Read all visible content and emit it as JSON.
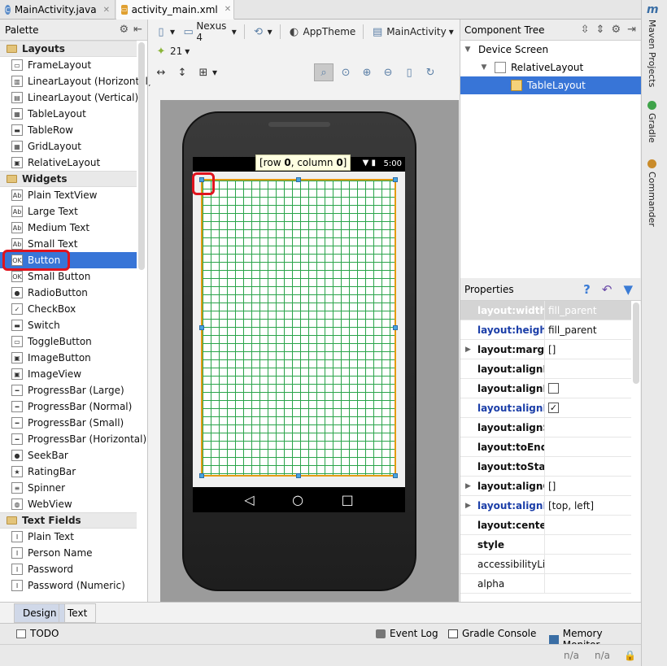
{
  "tabs": [
    {
      "label": "MainActivity.java",
      "icon": "java-class-icon"
    },
    {
      "label": "activity_main.xml",
      "icon": "xml-layout-icon"
    }
  ],
  "right_strip": {
    "top_label": "m",
    "items": [
      "Maven Projects",
      "Gradle",
      "Commander"
    ]
  },
  "palette": {
    "title": "Palette",
    "categories": [
      {
        "label": "Layouts",
        "items": [
          "FrameLayout",
          "LinearLayout (Horizontal)",
          "LinearLayout (Vertical)",
          "TableLayout",
          "TableRow",
          "GridLayout",
          "RelativeLayout"
        ]
      },
      {
        "label": "Widgets",
        "items": [
          "Plain TextView",
          "Large Text",
          "Medium Text",
          "Small Text",
          "Button",
          "Small Button",
          "RadioButton",
          "CheckBox",
          "Switch",
          "ToggleButton",
          "ImageButton",
          "ImageView",
          "ProgressBar (Large)",
          "ProgressBar (Normal)",
          "ProgressBar (Small)",
          "ProgressBar (Horizontal)",
          "SeekBar",
          "RatingBar",
          "Spinner",
          "WebView"
        ]
      },
      {
        "label": "Text Fields",
        "items": [
          "Plain Text",
          "Person Name",
          "Password",
          "Password (Numeric)"
        ]
      }
    ],
    "selected_item": "Button"
  },
  "toolbar": {
    "device": "Nexus 4",
    "theme": "AppTheme",
    "activity": "MainActivity",
    "api_level": "21"
  },
  "preview": {
    "tooltip_prefix": "[row ",
    "tooltip_row": "0",
    "tooltip_mid": ", column ",
    "tooltip_col": "0",
    "tooltip_suffix": "]",
    "status_time": "5:00"
  },
  "component_tree": {
    "title": "Component Tree",
    "nodes": [
      {
        "label": "Device Screen",
        "level": 0
      },
      {
        "label": "RelativeLayout",
        "level": 1
      },
      {
        "label": "TableLayout",
        "level": 2,
        "selected": true
      }
    ]
  },
  "properties": {
    "title": "Properties",
    "rows": [
      {
        "name": "layout:width",
        "value": "fill_parent",
        "style": "header"
      },
      {
        "name": "layout:height",
        "value": "fill_parent",
        "style": "blue"
      },
      {
        "name": "layout:margin",
        "value": "[]",
        "style": "bold",
        "expandable": true
      },
      {
        "name": "layout:alignEnd",
        "value": "",
        "style": "bold"
      },
      {
        "name": "layout:alignParentStart",
        "value": "",
        "style": "bold",
        "checkbox": "unchecked"
      },
      {
        "name": "layout:alignParentLeft",
        "value": "",
        "style": "blue",
        "checkbox": "checked"
      },
      {
        "name": "layout:alignStart",
        "value": "",
        "style": "bold"
      },
      {
        "name": "layout:toEndOf",
        "value": "",
        "style": "bold"
      },
      {
        "name": "layout:toStartOf",
        "value": "",
        "style": "bold"
      },
      {
        "name": "layout:alignComponent",
        "value": "[]",
        "style": "bold",
        "expandable": true
      },
      {
        "name": "layout:alignParent",
        "value": "[top, left]",
        "style": "blue",
        "expandable": true
      },
      {
        "name": "layout:centerInParent",
        "value": "",
        "style": "bold"
      },
      {
        "name": "style",
        "value": "",
        "style": "bold"
      },
      {
        "name": "accessibilityLiveRegion",
        "value": "",
        "style": "normal"
      },
      {
        "name": "alpha",
        "value": "",
        "style": "normal"
      }
    ]
  },
  "view_tabs": {
    "design": "Design",
    "text": "Text"
  },
  "bottom_tools": {
    "todo": "TODO",
    "event_log": "Event Log",
    "gradle_console": "Gradle Console",
    "memory_monitor": "Memory Monitor"
  },
  "status": {
    "na1": "n/a",
    "na2": "n/a"
  },
  "colors": {
    "selection": "#3875d7",
    "highlight_ring": "#e0141e",
    "grid_line": "#2aa44a",
    "table_border": "#e59b13"
  }
}
